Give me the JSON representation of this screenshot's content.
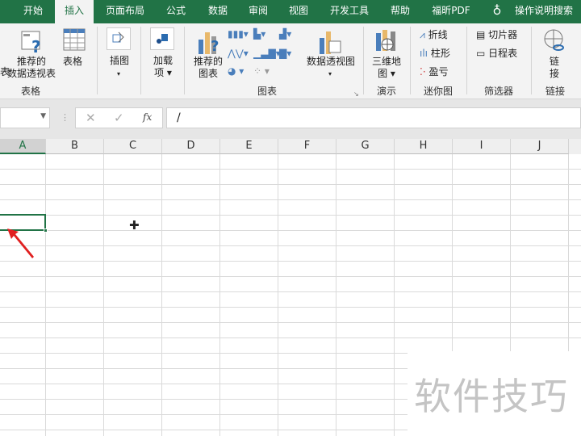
{
  "tabs": [
    {
      "label": "开始",
      "active": false
    },
    {
      "label": "插入",
      "active": true
    },
    {
      "label": "页面布局"
    },
    {
      "label": "公式"
    },
    {
      "label": "数据"
    },
    {
      "label": "审阅"
    },
    {
      "label": "视图"
    },
    {
      "label": "开发工具"
    },
    {
      "label": "帮助"
    },
    {
      "label": "福昕PDF"
    }
  ],
  "tell_me": "操作说明搜索",
  "ribbon": {
    "tables": {
      "pivot_partial": "表",
      "recommended_pivot": [
        "推荐的",
        "数据透视表"
      ],
      "table": "表格",
      "group": "表格"
    },
    "illustrations": {
      "label": "插图"
    },
    "addins": {
      "label": [
        "加载",
        "项"
      ]
    },
    "charts": {
      "recommended": [
        "推荐的",
        "图表"
      ],
      "pivot_chart": "数据透视图",
      "group": "图表"
    },
    "tours": {
      "map3d": [
        "三维地",
        "图"
      ],
      "group": "演示"
    },
    "sparklines": {
      "line": "折线",
      "column": "柱形",
      "winloss": "盈亏",
      "group": "迷你图"
    },
    "filters": {
      "slicer": "切片器",
      "timeline": "日程表",
      "group": "筛选器"
    },
    "links": {
      "link": [
        "链",
        "接"
      ],
      "group": "链接"
    }
  },
  "formula_bar": {
    "value": "/"
  },
  "columns": [
    "A",
    "B",
    "C",
    "D",
    "E",
    "F",
    "G",
    "H",
    "I",
    "J"
  ],
  "watermark": "软件技巧",
  "accent": "#217346"
}
